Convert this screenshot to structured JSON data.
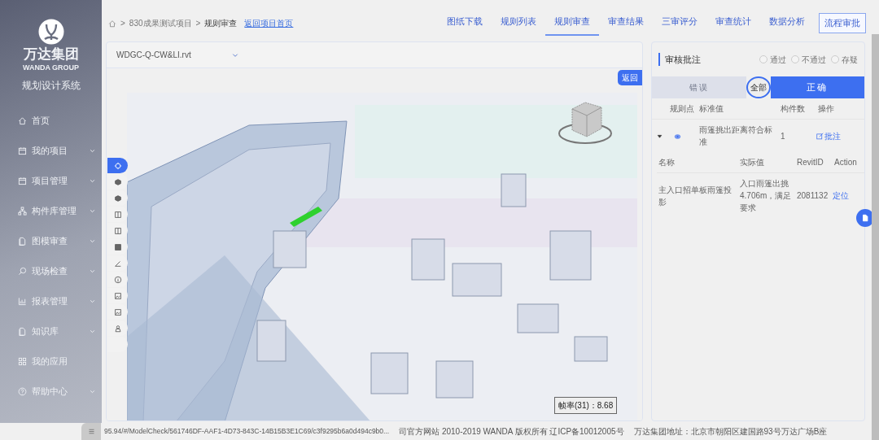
{
  "brand": {
    "name": "万达集团",
    "subtitle": "WANDA GROUP",
    "system": "规划设计系统"
  },
  "sidebar": {
    "items": [
      {
        "label": "首页",
        "expandable": false
      },
      {
        "label": "我的项目",
        "expandable": true
      },
      {
        "label": "项目管理",
        "expandable": true
      },
      {
        "label": "构件库管理",
        "expandable": true
      },
      {
        "label": "图模审查",
        "expandable": true
      },
      {
        "label": "现场检查",
        "expandable": true
      },
      {
        "label": "报表管理",
        "expandable": true
      },
      {
        "label": "知识库",
        "expandable": true
      },
      {
        "label": "我的应用",
        "expandable": false
      },
      {
        "label": "帮助中心",
        "expandable": true
      }
    ]
  },
  "breadcrumb": {
    "items": [
      {
        "separator": ">",
        "label": "830成果测试项目"
      },
      {
        "separator": ">",
        "label": "规则审查"
      }
    ],
    "link": "返回项目首页"
  },
  "nav": {
    "tabs": [
      {
        "label": "图纸下载",
        "selected": false
      },
      {
        "label": "规则列表",
        "selected": false
      },
      {
        "label": "规则审查",
        "selected": true
      },
      {
        "label": "审查结果",
        "selected": false
      },
      {
        "label": "三审评分",
        "selected": false
      },
      {
        "label": "审查统计",
        "selected": false
      },
      {
        "label": "数据分析",
        "selected": false
      }
    ],
    "button": "流程审批"
  },
  "viewer": {
    "file": "WDGC-Q-CW&LI.rvt",
    "back_button": "返回",
    "fps": "帧率(31)：8.68",
    "tools": [
      {
        "selected": true
      },
      {
        "selected": false
      },
      {
        "selected": false
      },
      {
        "selected": false
      },
      {
        "selected": false
      },
      {
        "selected": false
      },
      {
        "selected": false
      },
      {
        "selected": false
      },
      {
        "selected": false
      },
      {
        "selected": false
      },
      {
        "selected": false
      },
      {
        "selected": false
      }
    ]
  },
  "review": {
    "title": "审核批注",
    "options": [
      {
        "label": "通过",
        "checked": false
      },
      {
        "label": "不通过",
        "checked": false
      },
      {
        "label": "存疑",
        "checked": false
      }
    ],
    "switch": [
      {
        "label": "错误",
        "kind": "segment",
        "on": false
      },
      {
        "label": "全部",
        "kind": "knob",
        "on": true
      },
      {
        "label": "正确",
        "kind": "segment",
        "on": true
      }
    ],
    "columns": [
      "规则点",
      "标准值",
      "构件数",
      "操作"
    ],
    "rules": [
      {
        "expanded": true,
        "standard": "雨篷挑出距离符合标准",
        "count": "1",
        "action": "批注",
        "sub_columns": [
          "名称",
          "实际值",
          "RevitID",
          "Action"
        ],
        "elements": [
          {
            "name": "主入口招单板雨篷投影",
            "actual": "入口雨篷出挑4.706m，满足要求",
            "revit_id": "2081132",
            "action": "定位"
          }
        ]
      }
    ]
  },
  "footer": {
    "url": "95.94/#/ModelCheck/561746DF-AAF1-4D73-843C-14B15B3E1C69/c3f9295b6a0d494c9b0...",
    "copyright": "司官方网站 2010-2019 WANDA 版权所有 辽ICP备10012005号",
    "address": "万达集团地址：北京市朝阳区建国路93号万达广场B座"
  }
}
